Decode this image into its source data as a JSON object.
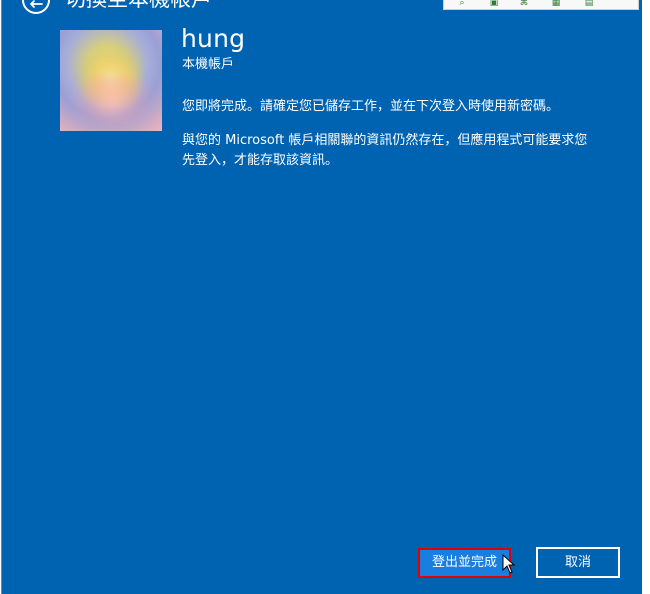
{
  "window": {
    "partial_title": "切換至本機帳戶",
    "toolbar_icons": [
      "search-icon",
      "save-icon",
      "share-icon",
      "apps-icon",
      "page-icon"
    ]
  },
  "account": {
    "username": "hung",
    "type_label": "本機帳戶"
  },
  "content": {
    "message_1": "您即將完成。請確定您已儲存工作，並在下次登入時使用新密碼。",
    "message_2": "與您的 Microsoft 帳戶相關聯的資訊仍然存在，但應用程式可能要求您先登入，才能存取該資訊。"
  },
  "actions": {
    "sign_out_finish": "登出並完成",
    "cancel": "取消"
  },
  "colors": {
    "background": "#0063b1",
    "primary_button": "#1a7de0",
    "highlight": "#e00000",
    "text": "#ffffff"
  }
}
